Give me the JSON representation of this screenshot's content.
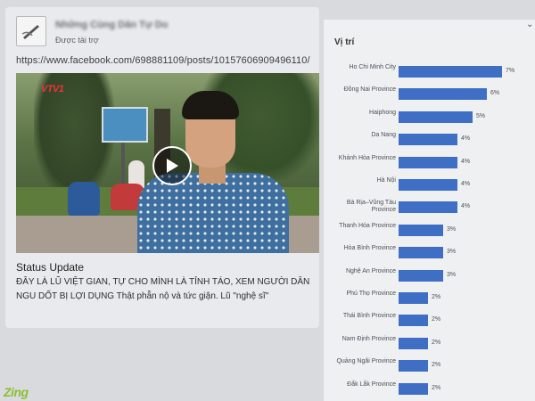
{
  "post": {
    "page_name": "Những Cùng Dân Tự Do",
    "sponsored_label": "Được tài trợ",
    "url": "https://www.facebook.com/698881109/posts/10157606909496110/",
    "video": {
      "channel_logo": "VTV1"
    },
    "status_title": "Status Update",
    "status_text": "ĐÂY LÀ LŨ VIỆT GIAN, TỰ CHO MÌNH LÀ TỈNH TÁO, XEM NGƯỜI DÂN NGU DỐT BỊ LỢI DỤNG Thật phẫn nộ và tức giận. Lũ \"nghệ sĩ\""
  },
  "location_panel": {
    "title": "Vị trí",
    "bar_color": "#3e6fc4",
    "chart_data": {
      "type": "bar",
      "orientation": "horizontal",
      "title": "Vị trí",
      "categories": [
        "Ho Chi Minh City",
        "Đồng Nai Province",
        "Haiphong",
        "Da Nang",
        "Khánh Hòa Province",
        "Hà Nội",
        "Bà Rịa–Vũng Tàu Province",
        "Thanh Hóa Province",
        "Hòa Bình Province",
        "Nghệ An Province",
        "Phú Thọ Province",
        "Thái Bình Province",
        "Nam Định Province",
        "Quảng Ngãi Province",
        "Đắk Lắk Province"
      ],
      "values": [
        7,
        6,
        5,
        4,
        4,
        4,
        4,
        3,
        3,
        3,
        2,
        2,
        2,
        2,
        2
      ],
      "value_labels": [
        "7%",
        "6%",
        "5%",
        "4%",
        "4%",
        "4%",
        "4%",
        "3%",
        "3%",
        "3%",
        "2%",
        "2%",
        "2%",
        "2%",
        "2%"
      ],
      "xlim": [
        0,
        7
      ]
    }
  },
  "brand": {
    "logo": "Zing"
  }
}
